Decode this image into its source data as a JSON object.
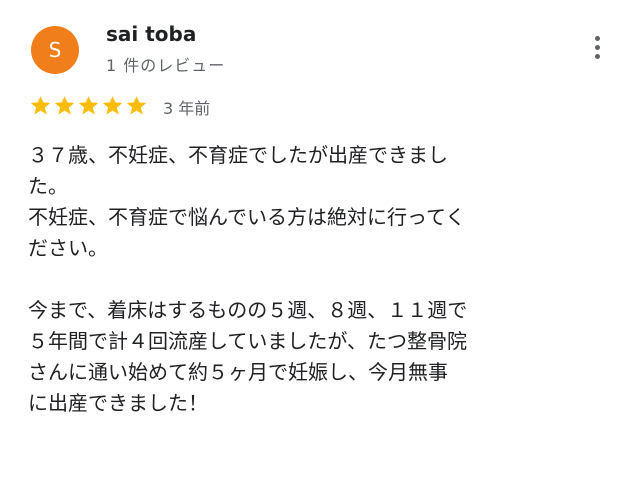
{
  "reviewer": {
    "avatar_initial": "S",
    "avatar_color": "#f07e1a",
    "name": "sai toba",
    "review_count": "1 件のレビュー"
  },
  "menu": {
    "icon": "more-vert-icon"
  },
  "rating": {
    "stars": 5,
    "max_stars": 5,
    "star_color": "#fbbc04",
    "date": "3 年前"
  },
  "body": {
    "line1": "３７歳、不妊症、不育症でしたが出産できまし",
    "line2": "た。",
    "line3": "不妊症、不育症で悩んでいる方は絶対に行ってく",
    "line4": "ださい。",
    "line5": "今まで、着床はするものの５週、８週、１１週で",
    "line6": "５年間で計４回流産していましたが、たつ整骨院",
    "line7": "さんに通い始めて約５ヶ月で妊娠し、今月無事",
    "line8": "に出産できました！"
  }
}
